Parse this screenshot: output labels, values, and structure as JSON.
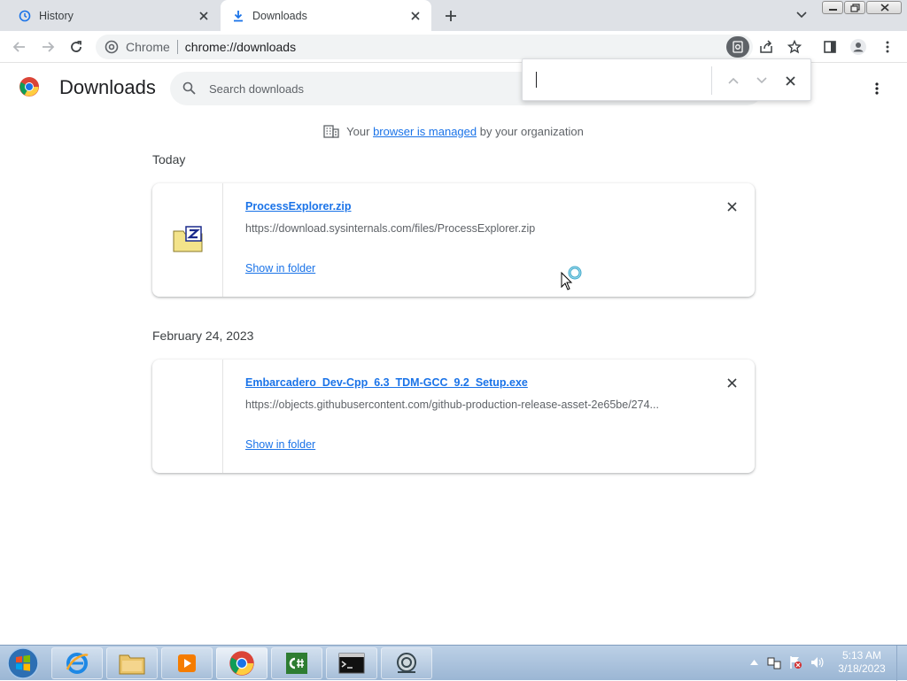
{
  "tabs": [
    {
      "title": "History",
      "active": false
    },
    {
      "title": "Downloads",
      "active": true
    }
  ],
  "toolbar": {
    "site_label": "Chrome",
    "url": "chrome://downloads"
  },
  "page": {
    "title": "Downloads",
    "search_placeholder": "Search downloads",
    "managed": {
      "prefix": "Your",
      "link": "browser is managed",
      "suffix": "by your organization"
    }
  },
  "groups": [
    {
      "date": "Today",
      "item": {
        "filename": "ProcessExplorer.zip",
        "url": "https://download.sysinternals.com/files/ProcessExplorer.zip",
        "action": "Show in folder",
        "icon": "zip-folder-icon"
      }
    },
    {
      "date": "February 24, 2023",
      "item": {
        "filename": "Embarcadero_Dev-Cpp_6.3_TDM-GCC_9.2_Setup.exe",
        "url": "https://objects.githubusercontent.com/github-production-release-asset-2e65be/274...",
        "action": "Show in folder",
        "icon": "blank-file-icon"
      }
    }
  ],
  "findbar": {
    "query": ""
  },
  "taskbar": {
    "time": "5:13 AM",
    "date": "3/18/2023",
    "apps": [
      "internet-explorer",
      "file-explorer",
      "media-player",
      "chrome",
      "csharp-editor",
      "command-prompt",
      "process-explorer"
    ]
  },
  "colors": {
    "link": "#1a73e8",
    "tabstrip": "#dee1e6",
    "taskbar": "#a9c1dc"
  }
}
